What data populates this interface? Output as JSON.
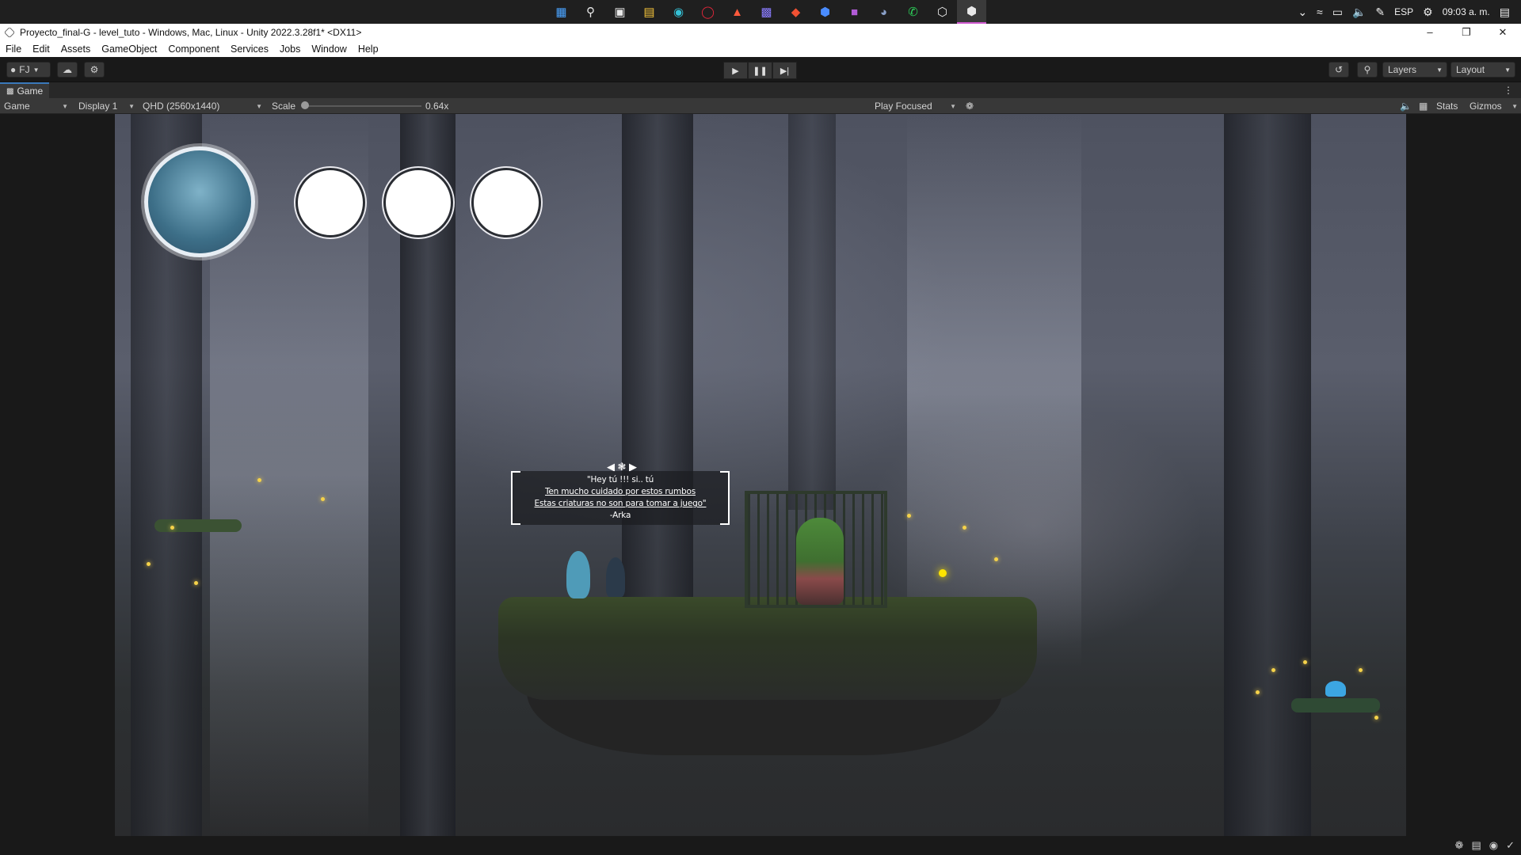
{
  "taskbar": {
    "icons": [
      "windows-start-icon",
      "search-icon",
      "task-view-icon",
      "file-explorer-icon",
      "edge-icon",
      "opera-icon",
      "adobe-acrobat-icon",
      "discord-icon",
      "git-icon",
      "vscode-icon",
      "app-icon",
      "steam-icon",
      "whatsapp-icon",
      "unity-hub-icon",
      "unity-editor-icon"
    ],
    "tray_language": "ESP",
    "tray_time": "09:03 a. m."
  },
  "titlebar": {
    "title": "Proyecto_final-G - level_tuto - Windows, Mac, Linux - Unity 2022.3.28f1* <DX11>",
    "minimize": "–",
    "restore": "❐",
    "close": "✕"
  },
  "menu": [
    "File",
    "Edit",
    "Assets",
    "GameObject",
    "Component",
    "Services",
    "Jobs",
    "Window",
    "Help"
  ],
  "toolbar": {
    "account": "FJ",
    "layers": "Layers",
    "layout": "Layout"
  },
  "game_view": {
    "tab": "Game",
    "view_mode": "Game",
    "display": "Display 1",
    "resolution": "QHD (2560x1440)",
    "scale_label": "Scale",
    "scale_value": "0.64x",
    "scale_fraction": 0.0,
    "play_mode": "Play Focused",
    "stats": "Stats",
    "gizmos": "Gizmos"
  },
  "dialog": {
    "line1": "\"Hey tú !!! si.. tú",
    "line2": "Ten mucho cuidado por estos rumbos",
    "line3": "Estas criaturas no son para tomar a juego\"",
    "line4": "-Arka"
  },
  "colors": {
    "editor_bg": "#191919",
    "panel_bg": "#383838",
    "accent": "#3a79bb",
    "firefly": "#f5d24a"
  }
}
